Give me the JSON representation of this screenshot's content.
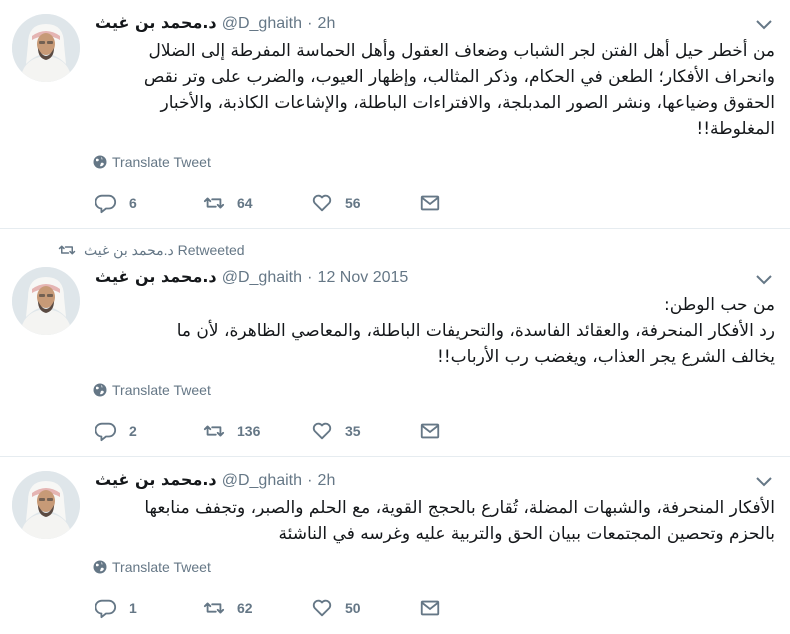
{
  "tweets": [
    {
      "author_name": "د.محمد بن غيث",
      "handle": "@D_ghaith",
      "dot": "·",
      "time": "2h",
      "text": "من أخطر حيل أهل الفتن لجر الشباب وضعاف العقول وأهل الحماسة المفرطة إلى الضلال\nوانحراف الأفكار؛ الطعن في الحكام، وذكر المثالب، وإظهار العيوب، والضرب على وتر نقص\nالحقوق وضياعها، ونشر الصور المدبلجة، والافتراءات الباطلة، والإشاعات الكاذبة، والأخبار\nالمغلوطة!!",
      "translate": "Translate Tweet",
      "replies": "6",
      "retweets": "64",
      "likes": "56"
    },
    {
      "retweeted_by": "د.محمد بن غيث Retweeted",
      "author_name": "د.محمد بن غيث",
      "handle": "@D_ghaith",
      "dot": "·",
      "time": "12 Nov 2015",
      "text": "من حب الوطن:\nرد الأفكار المنحرفة، والعقائد الفاسدة، والتحريفات الباطلة، والمعاصي الظاهرة، لأن ما\nيخالف الشرع يجر العذاب، ويغضب رب الأرباب!!",
      "translate": "Translate Tweet",
      "replies": "2",
      "retweets": "136",
      "likes": "35"
    },
    {
      "author_name": "د.محمد بن غيث",
      "handle": "@D_ghaith",
      "dot": "·",
      "time": "2h",
      "text": "الأفكار المنحرفة، والشبهات المضلة، تُقارع بالحجج القوية، مع الحلم والصبر، وتجفف منابعها\nبالحزم وتحصين المجتمعات ببيان الحق والتربية عليه وغرسه في الناشئة",
      "translate": "Translate Tweet",
      "replies": "1",
      "retweets": "62",
      "likes": "50"
    }
  ],
  "icons": {
    "avatar": "avatar-portrait",
    "caret": "chevron-down-icon",
    "globe": "globe-icon",
    "reply": "reply-icon",
    "retweet": "retweet-icon",
    "like": "heart-icon",
    "dm": "envelope-icon"
  },
  "colors": {
    "text": "#14171a",
    "secondary": "#657786",
    "divider": "#e6ecf0",
    "background": "#ffffff"
  }
}
